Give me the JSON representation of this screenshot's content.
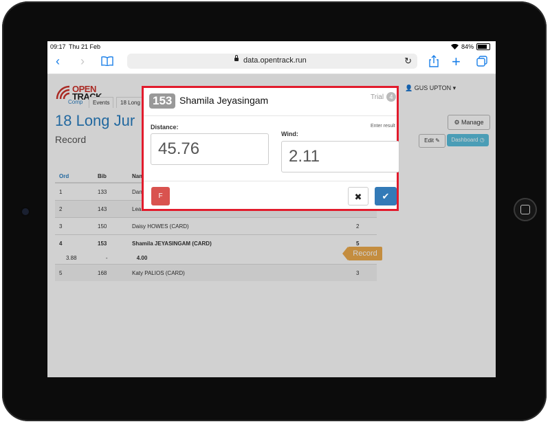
{
  "statusbar": {
    "time": "09:17",
    "date": "Thu 21 Feb",
    "battery": "84%"
  },
  "browser": {
    "url": "data.opentrack.run"
  },
  "site": {
    "logo_top": "OPEN",
    "logo_bottom": "TRACK",
    "user": "GUS UPTON ▾",
    "nav": [
      "Comp",
      "Events",
      "18 Long"
    ],
    "page_title": "18 Long Jur",
    "subtitle": "Record",
    "manage_label": "Manage",
    "edit_label": "Edit",
    "dashboard_label": "Dashboard"
  },
  "table": {
    "headers": [
      "Ord",
      "Bib",
      "Nam",
      ""
    ],
    "rows": [
      [
        "1",
        "133",
        "Dan",
        ""
      ],
      [
        "2",
        "143",
        "Lea",
        ""
      ],
      [
        "3",
        "150",
        "Daisy HOWES (CARD)",
        "2"
      ],
      [
        "4",
        "153",
        "Shamila JEYASINGAM (CARD)",
        "5"
      ],
      [
        "5",
        "168",
        "Katy PALIOS (CARD)",
        "3"
      ]
    ],
    "detail": {
      "first": "3.88",
      "dash": "-",
      "value": "4.00"
    },
    "record_label": "Record"
  },
  "modal": {
    "bib": "153",
    "athlete": "Shamila Jeyasingam",
    "trial_label": "Trial",
    "trial_number": "4",
    "distance_label": "Distance:",
    "distance_value": "45.76",
    "wind_label": "Wind:",
    "wind_value": "2.11",
    "enter_result": "Enter result",
    "foul_label": "F",
    "cancel_symbol": "✖",
    "confirm_symbol": "✔"
  },
  "icons": {
    "back": "chevron-left-icon",
    "forward": "chevron-right-icon",
    "bookmarks": "book-icon",
    "share": "share-icon",
    "add": "plus-icon",
    "tabs": "tabs-icon",
    "reload": "reload-icon",
    "lock": "lock-icon",
    "wifi": "wifi-icon",
    "battery": "battery-icon"
  },
  "colors": {
    "highlight_border": "#e21b2c",
    "primary": "#337ab7",
    "danger": "#d9534f",
    "warning": "#f0ad4e",
    "info": "#5bc0de",
    "ios_blue": "#1a7fe8"
  }
}
